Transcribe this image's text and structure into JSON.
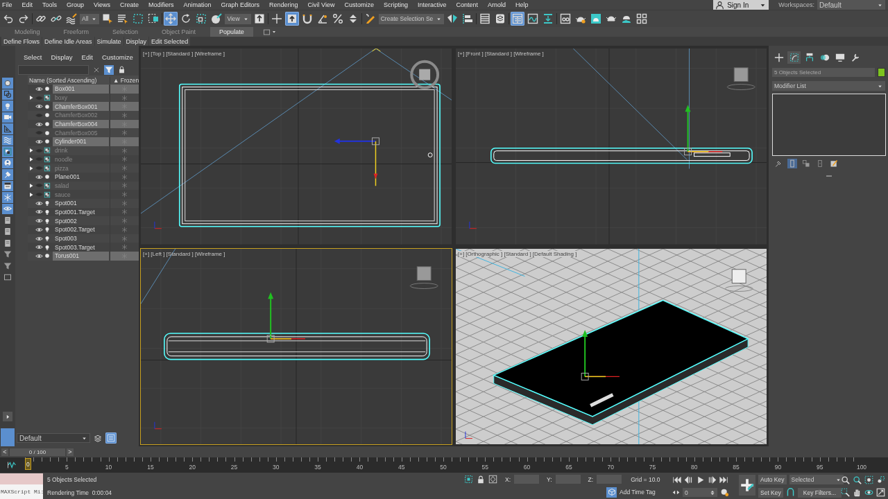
{
  "menu_bar": {
    "items": [
      "File",
      "Edit",
      "Tools",
      "Group",
      "Views",
      "Create",
      "Modifiers",
      "Animation",
      "Graph Editors",
      "Rendering",
      "Civil View",
      "Customize",
      "Scripting",
      "Interactive",
      "Content",
      "Arnold",
      "Help"
    ],
    "sign_in": "Sign In",
    "workspaces_label": "Workspaces:",
    "workspace": "Default"
  },
  "main_toolbar": [
    {
      "kind": "button",
      "selected": false
    },
    {
      "kind": "button",
      "selected": false
    },
    {
      "kind": "separator"
    },
    {
      "kind": "button",
      "selected": false
    },
    {
      "kind": "button",
      "selected": false
    },
    {
      "kind": "button",
      "selected": false
    },
    {
      "kind": "dropdown",
      "value": "All"
    },
    {
      "kind": "button",
      "selected": false
    },
    {
      "kind": "button",
      "selected": false
    },
    {
      "kind": "button",
      "selected": false
    },
    {
      "kind": "button",
      "selected": false
    },
    {
      "kind": "separator"
    },
    {
      "kind": "button",
      "selected": true
    },
    {
      "kind": "button",
      "selected": false
    },
    {
      "kind": "button",
      "selected": false
    },
    {
      "kind": "button",
      "selected": false
    },
    {
      "kind": "dropdown",
      "value": "View"
    },
    {
      "kind": "button",
      "selected": false
    },
    {
      "kind": "separator"
    },
    {
      "kind": "button",
      "selected": false
    },
    {
      "kind": "button",
      "selected": true
    },
    {
      "kind": "button",
      "selected": false
    },
    {
      "kind": "button",
      "selected": false
    },
    {
      "kind": "button",
      "selected": false
    },
    {
      "kind": "button",
      "selected": false
    },
    {
      "kind": "separator"
    },
    {
      "kind": "button",
      "selected": false
    },
    {
      "kind": "dropdown",
      "value": "Create Selection Se"
    },
    {
      "kind": "button",
      "selected": false
    },
    {
      "kind": "button",
      "selected": false
    },
    {
      "kind": "separator"
    },
    {
      "kind": "button",
      "selected": false
    },
    {
      "kind": "button",
      "selected": false
    },
    {
      "kind": "separator"
    },
    {
      "kind": "button",
      "selected": true
    },
    {
      "kind": "button",
      "selected": false
    },
    {
      "kind": "button",
      "selected": false
    },
    {
      "kind": "separator"
    },
    {
      "kind": "button",
      "selected": false
    },
    {
      "kind": "button",
      "selected": false
    },
    {
      "kind": "button",
      "selected": false
    },
    {
      "kind": "button",
      "selected": false
    },
    {
      "kind": "button",
      "selected": false
    },
    {
      "kind": "button",
      "selected": false
    }
  ],
  "ribbon": {
    "tabs": [
      {
        "label": "Modeling",
        "selected": false
      },
      {
        "label": "Freeform",
        "selected": false
      },
      {
        "label": "Selection",
        "selected": false
      },
      {
        "label": "Object Paint",
        "selected": false
      },
      {
        "label": "Populate",
        "selected": true
      }
    ],
    "panels": [
      "Define Flows",
      "Define Idle Areas",
      "Simulate",
      "Display",
      "Edit Selected"
    ]
  },
  "filter_toggles": [
    {
      "selected": true
    },
    {
      "selected": true
    },
    {
      "selected": true
    },
    {
      "selected": true
    },
    {
      "selected": true
    },
    {
      "selected": true
    },
    {
      "selected": true
    },
    {
      "selected": true
    },
    {
      "selected": true
    },
    {
      "selected": true
    },
    {
      "selected": true
    },
    {
      "selected": true
    },
    {
      "selected": false
    },
    {
      "selected": false
    },
    {
      "selected": false
    },
    {
      "selected": false
    },
    {
      "selected": false
    },
    {
      "selected": false
    }
  ],
  "scene_explorer": {
    "menu": [
      "Select",
      "Display",
      "Edit",
      "Customize"
    ],
    "filter_selected": true,
    "columns": [
      "Name (Sorted Ascending)",
      "▲ Frozen"
    ],
    "rows": [
      {
        "name": "Box001",
        "kind": "geometry",
        "visible": true,
        "selected": true,
        "expandable": false
      },
      {
        "name": "boxy",
        "kind": "group",
        "visible": false,
        "selected": false,
        "expandable": true
      },
      {
        "name": "ChamferBox001",
        "kind": "geometry",
        "visible": true,
        "selected": true,
        "expandable": false
      },
      {
        "name": "ChamferBox002",
        "kind": "geometry",
        "visible": false,
        "selected": false,
        "expandable": false
      },
      {
        "name": "ChamferBox004",
        "kind": "geometry",
        "visible": true,
        "selected": true,
        "expandable": false
      },
      {
        "name": "ChamferBox005",
        "kind": "geometry",
        "visible": false,
        "selected": false,
        "expandable": false
      },
      {
        "name": "Cylinder001",
        "kind": "geometry",
        "visible": true,
        "selected": true,
        "expandable": false
      },
      {
        "name": "drink",
        "kind": "group",
        "visible": false,
        "selected": false,
        "expandable": true
      },
      {
        "name": "noodle",
        "kind": "group",
        "visible": false,
        "selected": false,
        "expandable": true
      },
      {
        "name": "pizza",
        "kind": "group",
        "visible": false,
        "selected": false,
        "expandable": true
      },
      {
        "name": "Plane001",
        "kind": "geometry",
        "visible": true,
        "selected": false,
        "expandable": false
      },
      {
        "name": "salad",
        "kind": "group",
        "visible": false,
        "selected": false,
        "expandable": true
      },
      {
        "name": "sauce",
        "kind": "group",
        "visible": false,
        "selected": false,
        "expandable": true
      },
      {
        "name": "Spot001",
        "kind": "light",
        "visible": true,
        "selected": false,
        "expandable": false
      },
      {
        "name": "Spot001.Target",
        "kind": "light",
        "visible": true,
        "selected": false,
        "expandable": false
      },
      {
        "name": "Spot002",
        "kind": "light",
        "visible": true,
        "selected": false,
        "expandable": false
      },
      {
        "name": "Spot002.Target",
        "kind": "light",
        "visible": true,
        "selected": false,
        "expandable": false
      },
      {
        "name": "Spot003",
        "kind": "light",
        "visible": true,
        "selected": false,
        "expandable": false
      },
      {
        "name": "Spot003.Target",
        "kind": "light",
        "visible": true,
        "selected": false,
        "expandable": false
      },
      {
        "name": "Torus001",
        "kind": "geometry",
        "visible": true,
        "selected": true,
        "expandable": false
      }
    ],
    "layer": "Default"
  },
  "viewports": [
    {
      "kind": "top",
      "label": "[+] [Top ] [Standard ] [Wireframe ]",
      "active": false
    },
    {
      "kind": "front",
      "label": "[+] [Front ] [Standard ] [Wireframe ]",
      "active": false
    },
    {
      "kind": "left",
      "label": "[+] [Left ] [Standard ] [Wireframe ]",
      "active": true
    },
    {
      "kind": "ortho",
      "label": "[+] [Orthographic ] [Standard ] [Default Shading ]",
      "active": false
    }
  ],
  "command_panel": {
    "tabs": [
      {
        "selected": false
      },
      {
        "selected": true
      },
      {
        "selected": false
      },
      {
        "selected": false
      },
      {
        "selected": false
      },
      {
        "selected": false
      }
    ],
    "selection_name": "5 Objects Selected",
    "modifier_list": "Modifier List",
    "stack_tools": [
      {
        "selected": false
      },
      {
        "selected": true
      },
      {
        "selected": false
      },
      {
        "selected": false
      },
      {
        "selected": false
      }
    ]
  },
  "time_slider": {
    "prev": "<",
    "position": "0 / 100",
    "next": ">",
    "level": 0
  },
  "track_bar": [
    {
      "label": "0",
      "current": true
    },
    {
      "label": "5",
      "current": false
    },
    {
      "label": "10",
      "current": false
    },
    {
      "label": "15",
      "current": false
    },
    {
      "label": "20",
      "current": false
    },
    {
      "label": "25",
      "current": false
    },
    {
      "label": "30",
      "current": false
    },
    {
      "label": "35",
      "current": false
    },
    {
      "label": "40",
      "current": false
    },
    {
      "label": "45",
      "current": false
    },
    {
      "label": "50",
      "current": false
    },
    {
      "label": "55",
      "current": false
    },
    {
      "label": "60",
      "current": false
    },
    {
      "label": "65",
      "current": false
    },
    {
      "label": "70",
      "current": false
    },
    {
      "label": "75",
      "current": false
    },
    {
      "label": "80",
      "current": false
    },
    {
      "label": "85",
      "current": false
    },
    {
      "label": "90",
      "current": false
    },
    {
      "label": "95",
      "current": false
    },
    {
      "label": "100",
      "current": false
    }
  ],
  "status_bar": {
    "maxscript": "MAXScript Mi:",
    "selection": "5 Objects Selected",
    "render_time": "Rendering Time  0:00:04",
    "coords": [
      {
        "label": "X:"
      },
      {
        "label": "Y:"
      },
      {
        "label": "Z:"
      }
    ],
    "grid": "Grid = 10.0",
    "add_time_tag": "Add Time Tag",
    "frame": "0",
    "auto_key": "Auto Key",
    "key_mode": "Selected",
    "set_key": "Set Key",
    "key_filters": "Key Filters..."
  }
}
